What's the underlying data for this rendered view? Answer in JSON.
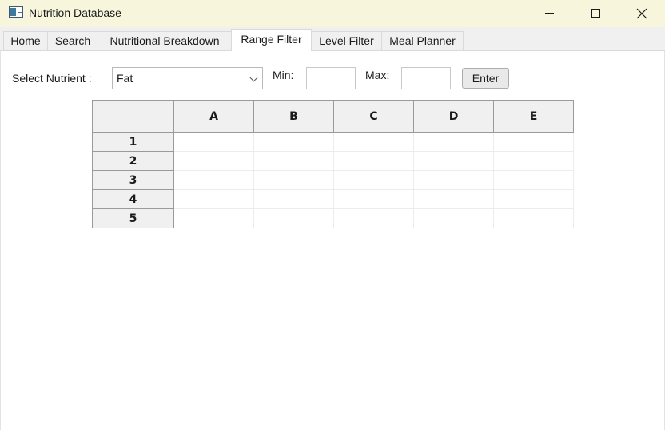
{
  "window": {
    "title": "Nutrition Database",
    "icon": "app-window-icon",
    "controls": [
      "minimize-icon",
      "maximize-icon",
      "close-icon"
    ]
  },
  "tabs": [
    {
      "label": "Home",
      "active": false
    },
    {
      "label": "Search",
      "active": false
    },
    {
      "label": "Nutritional Breakdown",
      "active": false
    },
    {
      "label": "Range Filter",
      "active": true
    },
    {
      "label": "Level Filter",
      "active": false
    },
    {
      "label": "Meal Planner",
      "active": false
    }
  ],
  "filter": {
    "select_label": "Select Nutrient :",
    "selected_nutrient": "Fat",
    "min_label": "Min:",
    "min_value": "",
    "max_label": "Max:",
    "max_value": "",
    "enter_label": "Enter"
  },
  "grid": {
    "columns": [
      "A",
      "B",
      "C",
      "D",
      "E"
    ],
    "rows": [
      "1",
      "2",
      "3",
      "4",
      "5"
    ]
  },
  "colors": {
    "titlebar": "#f8f5dd",
    "tabstrip": "#f0f0f0",
    "header_cells": "#f0f0f0"
  }
}
